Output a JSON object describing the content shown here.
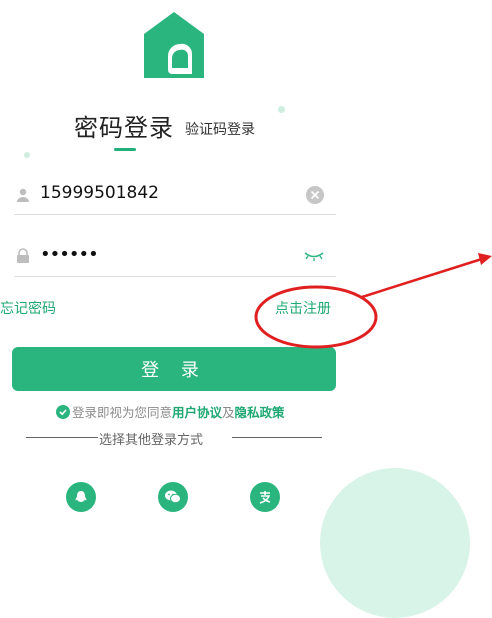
{
  "header": {
    "title": "密码登录",
    "alt_tab": "验证码登录"
  },
  "form": {
    "phone_value": "15999501842",
    "password_mask": "••••••",
    "forgot_password": "忘记密码",
    "register": "点击注册",
    "login_button": "登 录"
  },
  "agreement": {
    "prefix": "登录即视为您同意",
    "user_agreement": "用户协议",
    "and": "及",
    "privacy_policy": "隐私政策"
  },
  "other_login": {
    "label": "选择其他登录方式",
    "options": [
      "qq-icon",
      "wechat-icon",
      "alipay-icon"
    ]
  },
  "colors": {
    "brand": "#2bb57e",
    "link": "#1fa872",
    "annotation": "#e02020"
  }
}
